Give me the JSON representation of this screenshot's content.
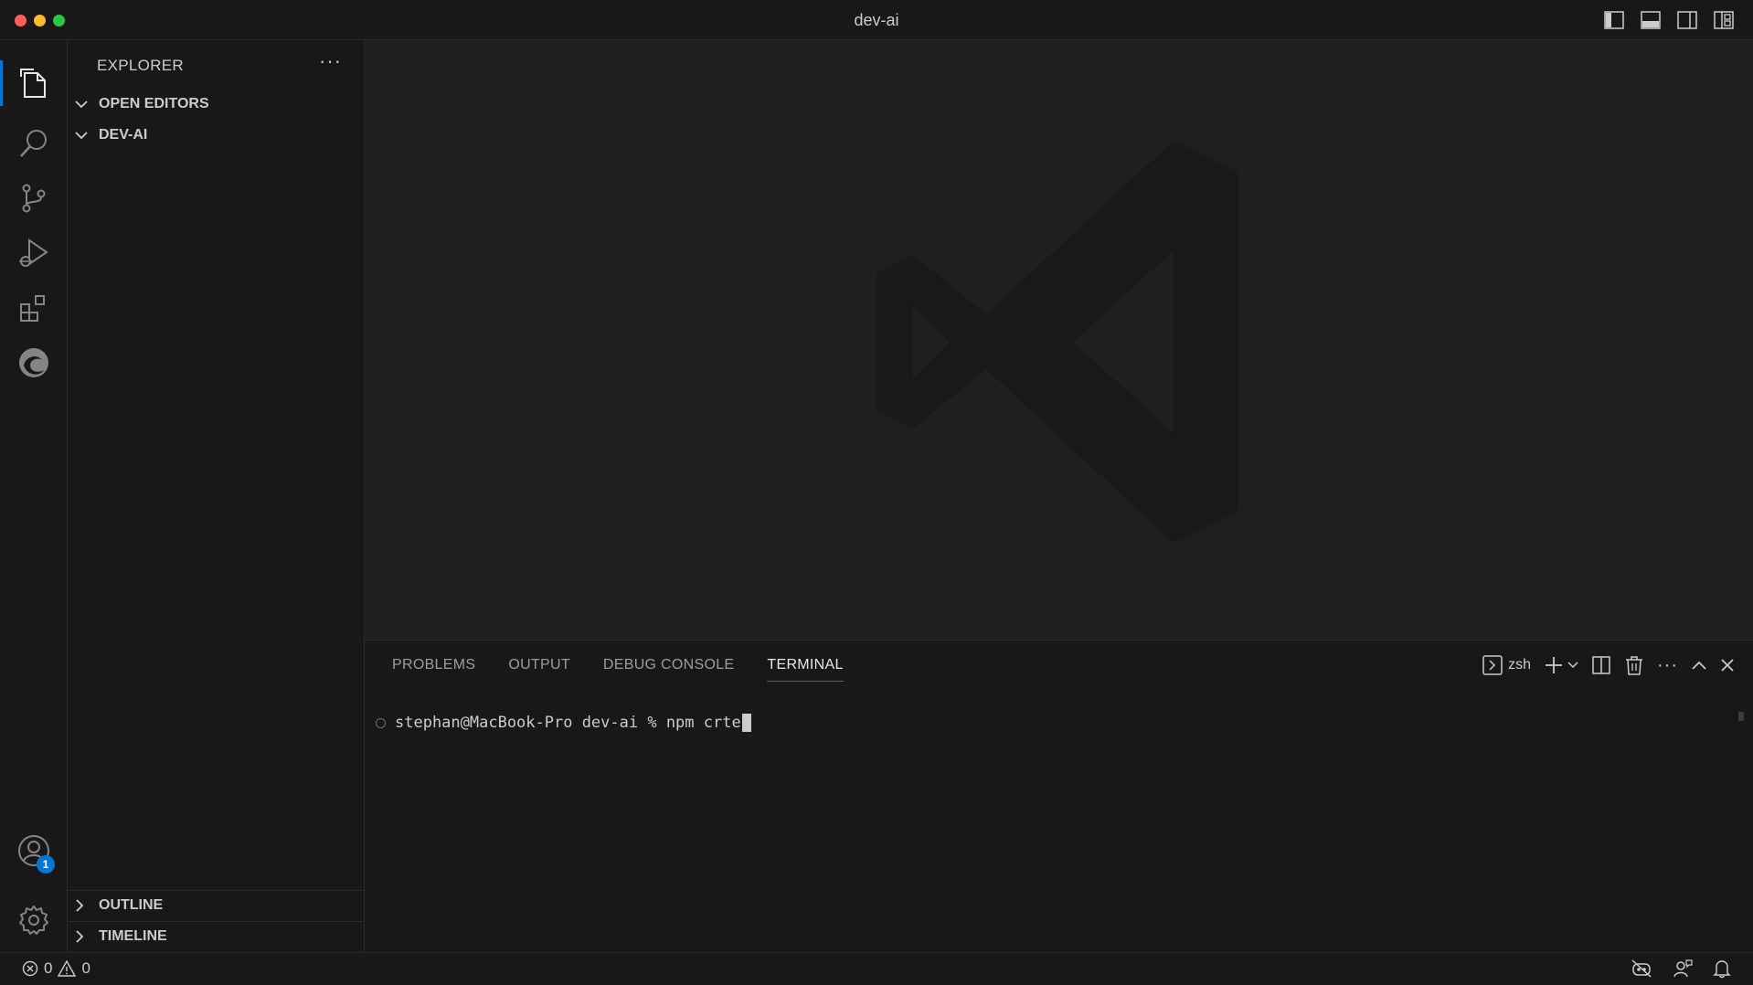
{
  "window": {
    "title": "dev-ai"
  },
  "sidebar": {
    "title": "EXPLORER",
    "sections": {
      "open_editors": "OPEN EDITORS",
      "project": "DEV-AI",
      "outline": "OUTLINE",
      "timeline": "TIMELINE"
    }
  },
  "accounts": {
    "badge": "1"
  },
  "panel": {
    "tabs": [
      "PROBLEMS",
      "OUTPUT",
      "DEBUG CONSOLE",
      "TERMINAL"
    ],
    "active_tab": "TERMINAL",
    "shell": "zsh"
  },
  "terminal": {
    "prompt": "stephan@MacBook-Pro dev-ai % ",
    "input": "npm crte"
  },
  "status": {
    "errors": "0",
    "warnings": "0"
  },
  "colors": {
    "accent": "#0078d4",
    "background": "#1e1e1e",
    "sidebar": "#181818"
  }
}
